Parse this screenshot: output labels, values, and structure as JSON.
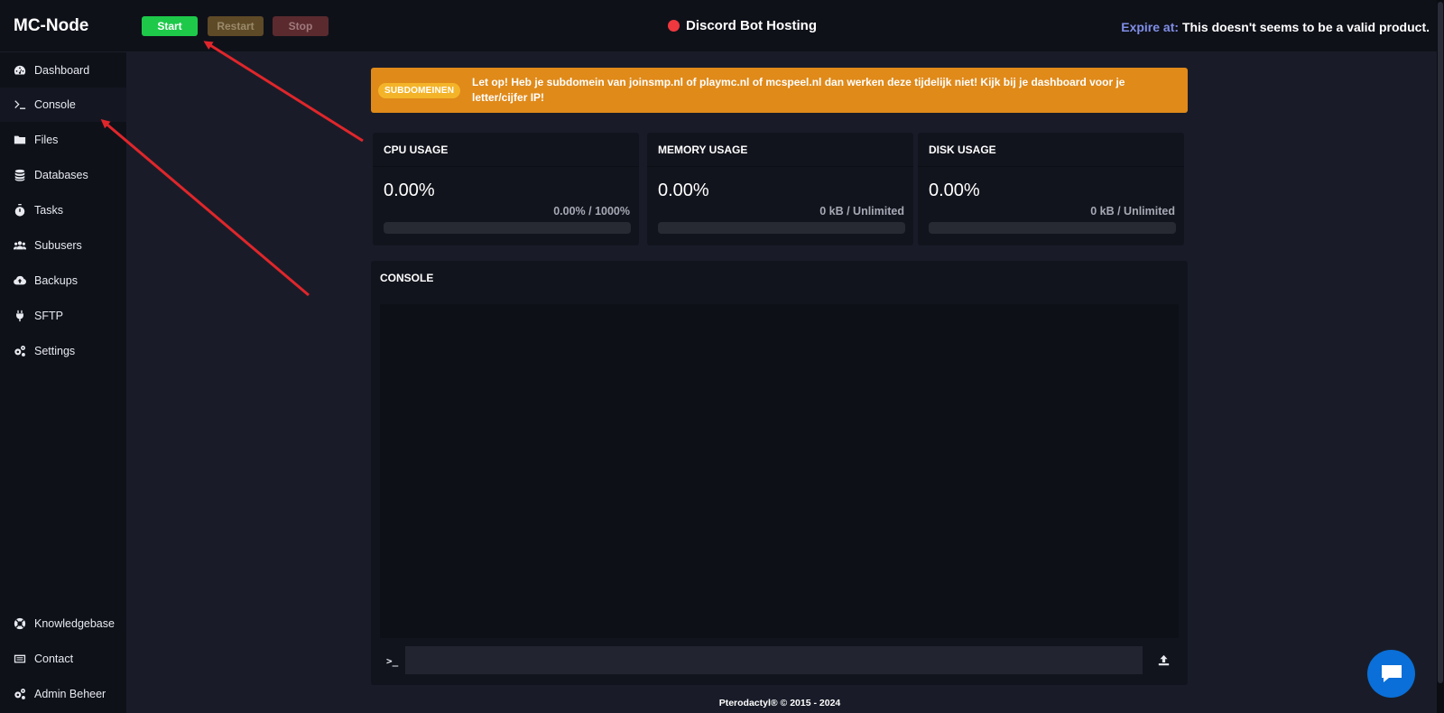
{
  "app": {
    "brand": "MC-Node",
    "server_name": "Discord Bot Hosting",
    "expire_label": "Expire at:",
    "expire_value": "This doesn't seems to be a valid product."
  },
  "power": {
    "start": "Start",
    "restart": "Restart",
    "stop": "Stop"
  },
  "sidebar": {
    "items": [
      {
        "label": "Dashboard",
        "icon": "dashboard-icon"
      },
      {
        "label": "Console",
        "icon": "terminal-icon"
      },
      {
        "label": "Files",
        "icon": "folder-icon"
      },
      {
        "label": "Databases",
        "icon": "database-icon"
      },
      {
        "label": "Tasks",
        "icon": "stopwatch-icon"
      },
      {
        "label": "Subusers",
        "icon": "users-icon"
      },
      {
        "label": "Backups",
        "icon": "cloud-upload-icon"
      },
      {
        "label": "SFTP",
        "icon": "plug-icon"
      },
      {
        "label": "Settings",
        "icon": "gears-icon"
      }
    ],
    "bottom_items": [
      {
        "label": "Knowledgebase",
        "icon": "lifebuoy-icon"
      },
      {
        "label": "Contact",
        "icon": "contact-card-icon"
      },
      {
        "label": "Admin Beheer",
        "icon": "gears-icon"
      }
    ]
  },
  "alert": {
    "badge": "SUBDOMEINEN",
    "text": "Let op! Heb je subdomein van joinsmp.nl of playmc.nl of mcspeel.nl dan werken deze tijdelijk niet! Kijk bij je dashboard voor je letter/cijfer IP!"
  },
  "stats": {
    "cpu": {
      "title": "CPU USAGE",
      "value": "0.00%",
      "sub": "0.00% / 1000%",
      "fill_pct": 0
    },
    "memory": {
      "title": "MEMORY USAGE",
      "value": "0.00%",
      "sub": "0 kB / Unlimited",
      "fill_pct": 0
    },
    "disk": {
      "title": "DISK USAGE",
      "value": "0.00%",
      "sub": "0 kB / Unlimited",
      "fill_pct": 0
    }
  },
  "console": {
    "title": "CONSOLE",
    "prompt": ">_",
    "input_value": ""
  },
  "footer": {
    "text": "Pterodactyl® © 2015 - 2024"
  },
  "colors": {
    "start": "#1ec94a",
    "status_offline": "#f0383f",
    "alert": "#e08a1a",
    "chat": "#0a6fd8",
    "annotation_arrow": "#e0262b"
  }
}
